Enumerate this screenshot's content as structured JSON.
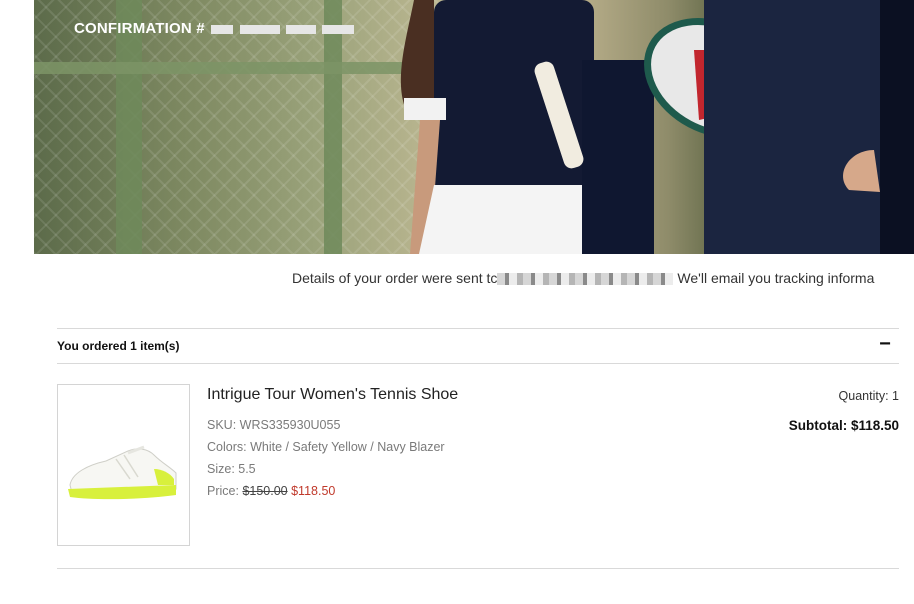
{
  "hero": {
    "confirmation_label": "CONFIRMATION #"
  },
  "notice": {
    "prefix": "Details of your order were sent tc",
    "suffix": "We'll email you tracking informa"
  },
  "order": {
    "ordered_label": "You ordered 1 item(s)",
    "collapse_symbol": "−",
    "item": {
      "name": "Intrigue Tour Women's Tennis Shoe",
      "sku": "SKU: WRS335930U055",
      "colors": "Colors: White / Safety Yellow / Navy Blazer",
      "size": "Size: 5.5",
      "price_label": "Price:",
      "original_price": "$150.00",
      "sale_price": "$118.50",
      "quantity": "Quantity: 1",
      "subtotal": "Subtotal: $118.50"
    }
  },
  "colors": {
    "sale_price": "#c0392b",
    "rule": "#d9d9d9",
    "shoe_accent": "#d8f03c"
  },
  "icons": [
    "collapse-minus-icon",
    "tennis-racket-icon",
    "tennis-shoe-icon"
  ]
}
